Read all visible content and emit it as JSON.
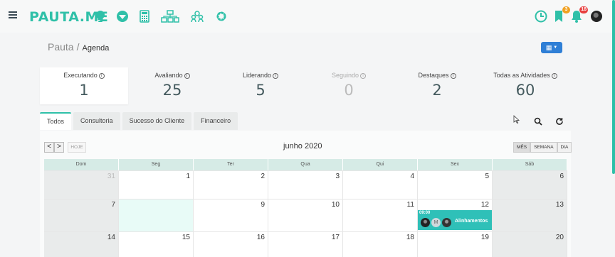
{
  "header": {
    "logo": "PAUTA.ME",
    "nav_icons": [
      "lightbulb-icon",
      "shield-icon",
      "calculator-icon",
      "org-chart-icon",
      "users-icon",
      "gear-icon"
    ],
    "right_icons": [
      "clock-icon",
      "bookmark-icon",
      "bell-icon"
    ],
    "bookmark_badge": "3",
    "bell_badge": "18"
  },
  "breadcrumb": {
    "root": "Pauta",
    "separator": "/",
    "current": "Agenda"
  },
  "stats": [
    {
      "label": "Executando",
      "value": "1"
    },
    {
      "label": "Avaliando",
      "value": "25"
    },
    {
      "label": "Liderando",
      "value": "5"
    },
    {
      "label": "Seguindo",
      "value": "0"
    },
    {
      "label": "Destaques",
      "value": "2"
    },
    {
      "label": "Todas as Atividades",
      "value": "60"
    }
  ],
  "tabs": [
    "Todos",
    "Consultoria",
    "Sucesso do Cliente",
    "Financeiro"
  ],
  "calendar": {
    "prev": "<",
    "next": ">",
    "today_label": "HOJE",
    "title": "junho 2020",
    "views": [
      "MÊS",
      "SEMANA",
      "DIA"
    ],
    "weekdays": [
      "Dom",
      "Seg",
      "Ter",
      "Qua",
      "Qui",
      "Sex",
      "Sáb"
    ],
    "weeks": [
      [
        "31",
        "1",
        "2",
        "3",
        "4",
        "5",
        "6"
      ],
      [
        "7",
        "8",
        "9",
        "10",
        "11",
        "12",
        "13"
      ],
      [
        "14",
        "15",
        "16",
        "17",
        "18",
        "19",
        "20"
      ]
    ],
    "event": {
      "time": "09:00",
      "label": "Alinhamentos",
      "avatar_initial": "M"
    }
  },
  "colors": {
    "brand": "#2fc0a8",
    "event": "#2fc0b8",
    "primary_button": "#2f7fd6",
    "bookmark_badge": "#f0a020",
    "bell_badge": "#e84040"
  }
}
